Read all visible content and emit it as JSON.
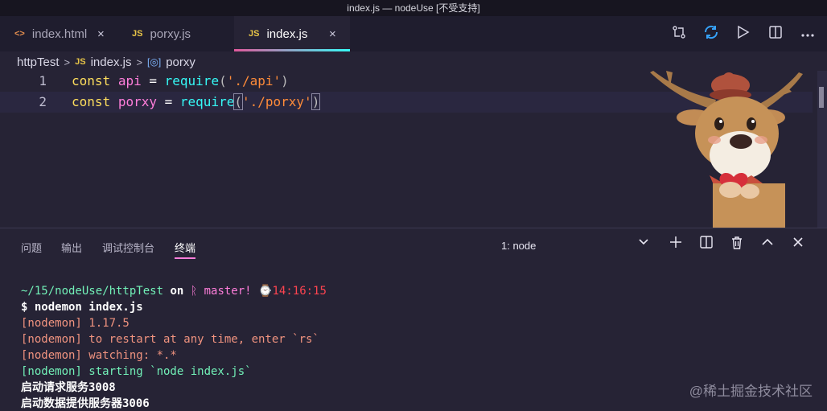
{
  "window": {
    "title": "index.js — nodeUse [不受支持]"
  },
  "tabs": [
    {
      "label": "index.html",
      "icon": "<>",
      "close": "×"
    },
    {
      "label": "porxy.js",
      "icon": "JS"
    },
    {
      "label": "index.js",
      "icon": "JS",
      "close": "×"
    }
  ],
  "tab_actions": [
    "git-compare-icon",
    "go-live-icon",
    "run-icon",
    "split-editor-icon",
    "more-icon"
  ],
  "breadcrumb": {
    "folder": "httpTest",
    "file": "index.js",
    "file_icon": "JS",
    "symbol": "porxy",
    "sep": ">",
    "symbol_icon": "[◎]"
  },
  "editor": {
    "lines": [
      {
        "num": "1",
        "kw": "const",
        "var": "api",
        "eq": "=",
        "fn": "require",
        "open": "(",
        "str": "'./api'",
        "close": ")"
      },
      {
        "num": "2",
        "kw": "const",
        "var": "porxy",
        "eq": "=",
        "fn": "require",
        "open": "(",
        "str": "'./porxy'",
        "close": ")"
      }
    ]
  },
  "panel": {
    "tabs": [
      "问题",
      "输出",
      "调试控制台",
      "终端"
    ],
    "terminal_select": "1: node",
    "chevron": "⌄"
  },
  "terminal": {
    "path": "~/15/nodeUse/httpTest",
    "on": "on",
    "branch_icon": "ᚱ",
    "branch": "master!",
    "clock_icon": "⌚",
    "time": "14:16:15",
    "command": "$ nodemon index.js",
    "logs": [
      "[nodemon] 1.17.5",
      "[nodemon] to restart at any time, enter `rs`",
      "[nodemon] watching: *.*"
    ],
    "starting": "[nodemon] starting `node index.js`",
    "output": [
      "启动请求服务3008",
      "启动数据提供服务器3006"
    ]
  },
  "watermark": "@稀土掘金技术社区",
  "colors": {
    "accent_pink": "#ff7edb",
    "accent_cyan": "#36f9f6",
    "editor_bg": "#262335"
  }
}
